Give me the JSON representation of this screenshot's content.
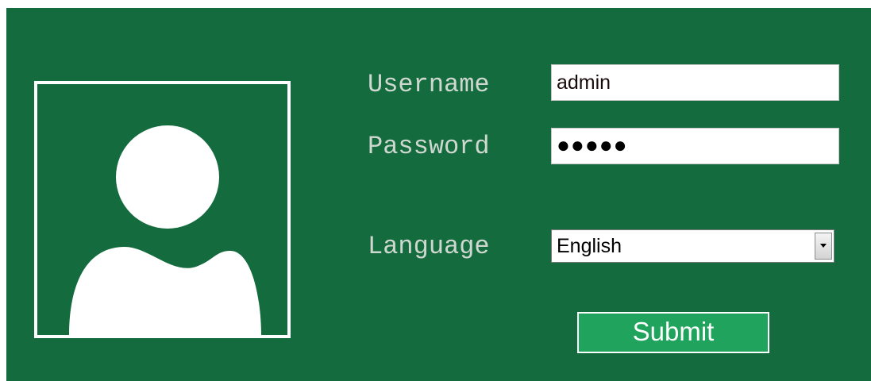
{
  "form": {
    "username_label": "Username",
    "username_value": "admin",
    "password_label": "Password",
    "password_mask": "●●●●●",
    "language_label": "Language",
    "language_selected": "English",
    "submit_label": "Submit"
  },
  "icons": {
    "avatar": "user-avatar-icon",
    "dropdown": "chevron-down-icon"
  },
  "colors": {
    "panel_bg": "#146b3d",
    "label_text": "#cfd8d0",
    "submit_bg": "#20a35c",
    "frame_border": "#ffffff"
  }
}
